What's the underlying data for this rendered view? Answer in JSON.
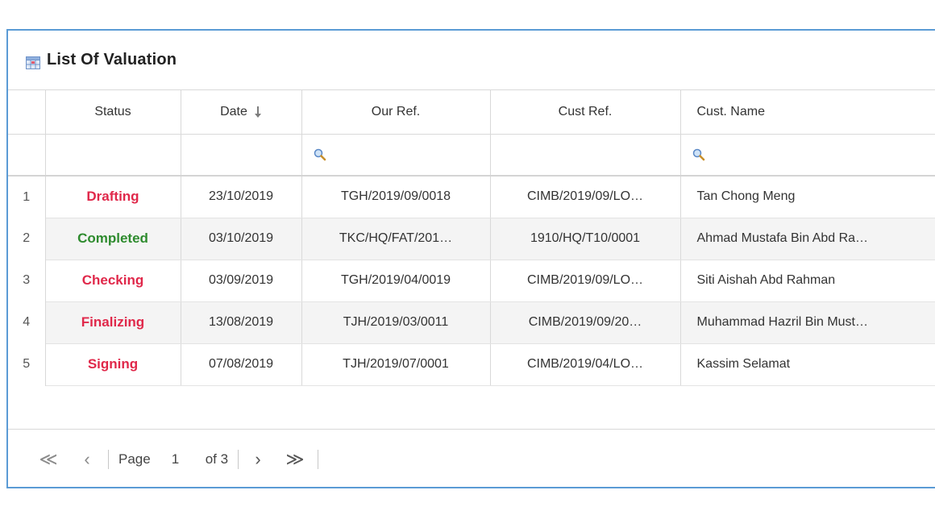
{
  "panel": {
    "title": "List Of Valuation"
  },
  "columns": {
    "status": "Status",
    "date": "Date",
    "our_ref": "Our Ref.",
    "cust_ref": "Cust Ref.",
    "cust_name": "Cust. Name"
  },
  "rows": [
    {
      "num": "1",
      "status": "Drafting",
      "status_color": "#e0284a",
      "date": "23/10/2019",
      "our_ref": "TGH/2019/09/0018",
      "cust_ref": "CIMB/2019/09/LO…",
      "cust_name": "Tan Chong Meng"
    },
    {
      "num": "2",
      "status": "Completed",
      "status_color": "#2e8b2e",
      "date": "03/10/2019",
      "our_ref": "TKC/HQ/FAT/201…",
      "cust_ref": "1910/HQ/T10/0001",
      "cust_name": "Ahmad Mustafa Bin Abd Ra…"
    },
    {
      "num": "3",
      "status": "Checking",
      "status_color": "#e0284a",
      "date": "03/09/2019",
      "our_ref": "TGH/2019/04/0019",
      "cust_ref": "CIMB/2019/09/LO…",
      "cust_name": "Siti Aishah Abd Rahman"
    },
    {
      "num": "4",
      "status": "Finalizing",
      "status_color": "#e0284a",
      "date": "13/08/2019",
      "our_ref": "TJH/2019/03/0011",
      "cust_ref": "CIMB/2019/09/20…",
      "cust_name": "Muhammad Hazril Bin Must…"
    },
    {
      "num": "5",
      "status": "Signing",
      "status_color": "#e0284a",
      "date": "07/08/2019",
      "our_ref": "TJH/2019/07/0001",
      "cust_ref": "CIMB/2019/04/LO…",
      "cust_name": "Kassim Selamat"
    }
  ],
  "pager": {
    "first": "≪",
    "prev": "‹",
    "page_label": "Page",
    "page_value": "1",
    "of_label": "of 3",
    "next": "›",
    "last": "≫"
  },
  "icons": {
    "title": "grid-icon",
    "filter": "magnifier-icon",
    "sort": "sort-down-arrow-icon"
  }
}
